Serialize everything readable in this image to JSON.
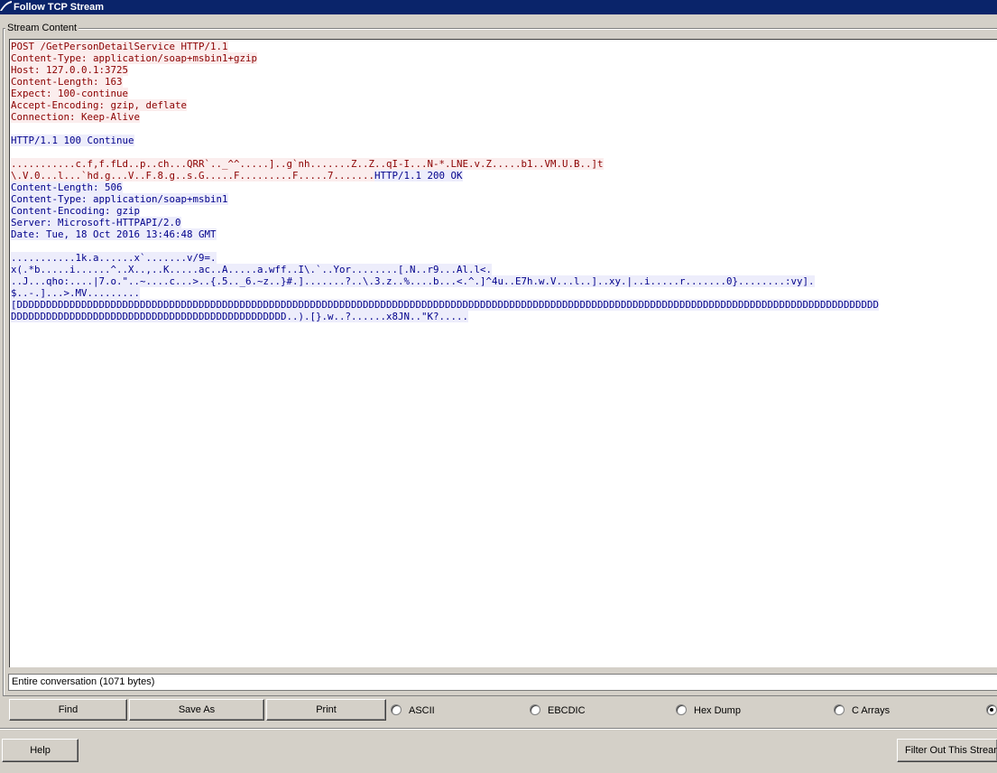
{
  "window": {
    "title": "Follow TCP Stream"
  },
  "group": {
    "legend": "Stream Content"
  },
  "stream": {
    "lines": [
      {
        "dir": "cli",
        "text": "POST /GetPersonDetailService HTTP/1.1"
      },
      {
        "dir": "cli",
        "text": "Content-Type: application/soap+msbin1+gzip"
      },
      {
        "dir": "cli",
        "text": "Host: 127.0.0.1:3725"
      },
      {
        "dir": "cli",
        "text": "Content-Length: 163"
      },
      {
        "dir": "cli",
        "text": "Expect: 100-continue"
      },
      {
        "dir": "cli",
        "text": "Accept-Encoding: gzip, deflate"
      },
      {
        "dir": "cli",
        "text": "Connection: Keep-Alive"
      },
      {
        "dir": "blank",
        "text": ""
      },
      {
        "dir": "srv",
        "text": "HTTP/1.1 100 Continue"
      },
      {
        "dir": "blank",
        "text": ""
      },
      {
        "dir": "cli",
        "text": "...........c.f,f.fLd..p..ch...QRR`.._^^.....]..g`nh.......Z..Z..qI-I...N-*.LNE.v.Z.....b1..VM.U.B..]t"
      },
      {
        "dir": "mixed",
        "cli": "\\.V.0...l...`hd.g...V..F.8.g..s.G.....F.........F.....7.......",
        "srv": "HTTP/1.1 200 OK"
      },
      {
        "dir": "srv",
        "text": "Content-Length: 506"
      },
      {
        "dir": "srv",
        "text": "Content-Type: application/soap+msbin1"
      },
      {
        "dir": "srv",
        "text": "Content-Encoding: gzip"
      },
      {
        "dir": "srv",
        "text": "Server: Microsoft-HTTPAPI/2.0"
      },
      {
        "dir": "srv",
        "text": "Date: Tue, 18 Oct 2016 13:46:48 GMT"
      },
      {
        "dir": "blank",
        "text": ""
      },
      {
        "dir": "srv",
        "text": "...........1k.a......x`.......v/9=."
      },
      {
        "dir": "srv",
        "text": "x(.*b.....i......^..X..,..K.....ac..A.....a.wff..I\\.`..Yor........[.N..r9...Al.l<."
      },
      {
        "dir": "srv",
        "text": "..J...qho:....|7.o.\"..~....c...>..{.5.._6.~z..}#.].......?..\\.3.z..%....b...<.^.]^4u..E7h.w.V...l..]..xy.|..i.....r.......0}........:vy]."
      },
      {
        "dir": "srv",
        "text": "$..-.]...>.MV........."
      },
      {
        "dir": "srv",
        "text": "[DDDDDDDDDDDDDDDDDDDDDDDDDDDDDDDDDDDDDDDDDDDDDDDDDDDDDDDDDDDDDDDDDDDDDDDDDDDDDDDDDDDDDDDDDDDDDDDDDDDDDDDDDDDDDDDDDDDDDDDDDDDDDDDDDDDDDDDDDDDDDDDDDDD"
      },
      {
        "dir": "srv",
        "text": "DDDDDDDDDDDDDDDDDDDDDDDDDDDDDDDDDDDDDDDDDDDDDDD..).[}.w..?......x8JN..\"K?.....",
        "caret": true
      }
    ]
  },
  "conversation_select": {
    "value": "Entire conversation (1071 bytes)"
  },
  "buttons": {
    "find": "Find",
    "save_as": "Save As",
    "print": "Print",
    "help": "Help",
    "filter_out": "Filter Out This Stream"
  },
  "format_options": {
    "ascii": "ASCII",
    "ebcdic": "EBCDIC",
    "hex_dump": "Hex Dump",
    "c_arrays": "C Arrays"
  },
  "colors": {
    "client_text": "#8b0000",
    "client_bg": "#fbeded",
    "server_text": "#00008b",
    "server_bg": "#ededfb",
    "titlebar": "#0a246a"
  }
}
